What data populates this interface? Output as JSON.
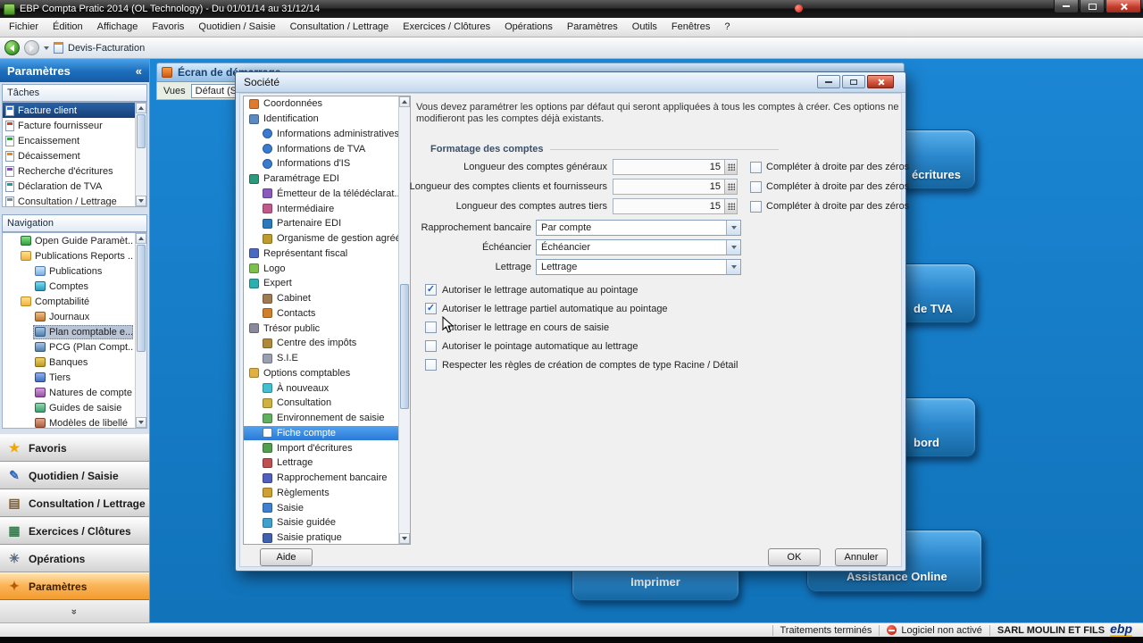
{
  "window": {
    "title": "EBP Compta Pratic 2014 (OL Technology) - Du 01/01/14 au 31/12/14"
  },
  "menubar": {
    "items": [
      "Fichier",
      "Édition",
      "Affichage",
      "Favoris",
      "Quotidien / Saisie",
      "Consultation / Lettrage",
      "Exercices / Clôtures",
      "Opérations",
      "Paramètres",
      "Outils",
      "Fenêtres",
      "?"
    ]
  },
  "toolbar": {
    "breadcrumb": "Devis-Facturation"
  },
  "sidebar": {
    "title": "Paramètres",
    "collapse_glyph": "«",
    "tasks_header": "Tâches",
    "tasks": [
      {
        "label": "Facture client",
        "icon": "doc-blue",
        "selected": true
      },
      {
        "label": "Facture fournisseur",
        "icon": "doc-red"
      },
      {
        "label": "Encaissement",
        "icon": "doc-green"
      },
      {
        "label": "Décaissement",
        "icon": "doc-orange"
      },
      {
        "label": "Recherche d'écritures",
        "icon": "doc-purple"
      },
      {
        "label": "Déclaration de TVA",
        "icon": "doc-teal"
      },
      {
        "label": "Consultation / Lettrage",
        "icon": "doc-gray"
      }
    ],
    "navigation_header": "Navigation",
    "nav": [
      {
        "label": "Open Guide Paramèt...",
        "level": 0,
        "icon": "guide"
      },
      {
        "label": "Publications Reports ...",
        "level": 0,
        "icon": "folder"
      },
      {
        "label": "Publications",
        "level": 1,
        "icon": "pages"
      },
      {
        "label": "Comptes",
        "level": 1,
        "icon": "gem"
      },
      {
        "label": "Comptabilité",
        "level": 0,
        "icon": "folder"
      },
      {
        "label": "Journaux",
        "level": 1,
        "icon": "journal"
      },
      {
        "label": "Plan comptable e...",
        "level": 1,
        "icon": "plan",
        "selected": true
      },
      {
        "label": "PCG (Plan Compt...)",
        "level": 1,
        "icon": "plan"
      },
      {
        "label": "Banques",
        "level": 1,
        "icon": "bank"
      },
      {
        "label": "Tiers",
        "level": 1,
        "icon": "person"
      },
      {
        "label": "Natures de compte",
        "level": 1,
        "icon": "nature"
      },
      {
        "label": "Guides de saisie",
        "level": 1,
        "icon": "guide2"
      },
      {
        "label": "Modèles de libellé",
        "level": 1,
        "icon": "model"
      }
    ],
    "accordion": [
      {
        "label": "Favoris",
        "icon": "star"
      },
      {
        "label": "Quotidien / Saisie",
        "icon": "pencil"
      },
      {
        "label": "Consultation / Lettrage",
        "icon": "book"
      },
      {
        "label": "Exercices / Clôtures",
        "icon": "calc"
      },
      {
        "label": "Opérations",
        "icon": "gears"
      },
      {
        "label": "Paramètres",
        "icon": "wrench",
        "active": true
      }
    ]
  },
  "start_screen": {
    "title": "Écran de démarrage",
    "views_label": "Vues",
    "views_value": "Défaut (Sys",
    "buttons": [
      {
        "label": "écritures"
      },
      {
        "label": "de TVA"
      },
      {
        "label": "bord"
      },
      {
        "label": "Imprimer"
      },
      {
        "label": "Assistance Online"
      }
    ]
  },
  "dialog": {
    "title": "Société",
    "description": "Vous devez paramétrer les options par défaut qui seront appliquées à tous les comptes  à créer. Ces options ne modifieront pas les comptes déjà existants.",
    "group_title": "Formatage des comptes",
    "tree": [
      {
        "label": "Coordonnées",
        "level": 0,
        "icon": "coord"
      },
      {
        "label": "Identification",
        "level": 0,
        "icon": "ident"
      },
      {
        "label": "Informations administratives",
        "level": 1,
        "icon": "info"
      },
      {
        "label": "Informations de TVA",
        "level": 1,
        "icon": "info"
      },
      {
        "label": "Informations d'IS",
        "level": 1,
        "icon": "info"
      },
      {
        "label": "Paramétrage EDI",
        "level": 0,
        "icon": "edi"
      },
      {
        "label": "Émetteur de la télédéclarat...",
        "level": 1,
        "icon": "emit"
      },
      {
        "label": "Intermédiaire",
        "level": 1,
        "icon": "inter"
      },
      {
        "label": "Partenaire EDI",
        "level": 1,
        "icon": "edi2"
      },
      {
        "label": "Organisme de gestion agréé",
        "level": 1,
        "icon": "org"
      },
      {
        "label": "Représentant fiscal",
        "level": 0,
        "icon": "rep"
      },
      {
        "label": "Logo",
        "level": 0,
        "icon": "logo"
      },
      {
        "label": "Expert",
        "level": 0,
        "icon": "expert"
      },
      {
        "label": "Cabinet",
        "level": 1,
        "icon": "cab"
      },
      {
        "label": "Contacts",
        "level": 1,
        "icon": "cont"
      },
      {
        "label": "Trésor public",
        "level": 0,
        "icon": "tresor"
      },
      {
        "label": "Centre des impôts",
        "level": 1,
        "icon": "centre"
      },
      {
        "label": "S.I.E",
        "level": 1,
        "icon": "sie"
      },
      {
        "label": "Options comptables",
        "level": 0,
        "icon": "opt"
      },
      {
        "label": "À nouveaux",
        "level": 1,
        "icon": "anouv"
      },
      {
        "label": "Consultation",
        "level": 1,
        "icon": "consult"
      },
      {
        "label": "Environnement de saisie",
        "level": 1,
        "icon": "env"
      },
      {
        "label": "Fiche compte",
        "level": 1,
        "icon": "fiche",
        "selected": true
      },
      {
        "label": "Import d'écritures",
        "level": 1,
        "icon": "import"
      },
      {
        "label": "Lettrage",
        "level": 1,
        "icon": "lettrage"
      },
      {
        "label": "Rapprochement bancaire",
        "level": 1,
        "icon": "rappro"
      },
      {
        "label": "Règlements",
        "level": 1,
        "icon": "regl"
      },
      {
        "label": "Saisie",
        "level": 1,
        "icon": "saisie"
      },
      {
        "label": "Saisie guidée",
        "level": 1,
        "icon": "saisieg"
      },
      {
        "label": "Saisie pratique",
        "level": 1,
        "icon": "saisiep"
      }
    ],
    "length_rows": [
      {
        "label": "Longueur des comptes généraux",
        "value": "15",
        "checked": false,
        "check_label": "Compléter à droite par des zéros"
      },
      {
        "label": "Longueur des comptes clients et fournisseurs",
        "value": "15",
        "checked": false,
        "check_label": "Compléter à droite par des zéros"
      },
      {
        "label": "Longueur des comptes autres tiers",
        "value": "15",
        "checked": false,
        "check_label": "Compléter à droite par des zéros"
      }
    ],
    "dropdown_rows": [
      {
        "label": "Rapprochement bancaire",
        "value": "Par compte"
      },
      {
        "label": "Échéancier",
        "value": "Échéancier"
      },
      {
        "label": "Lettrage",
        "value": "Lettrage"
      }
    ],
    "checkboxes": [
      {
        "label": "Autoriser le lettrage automatique au pointage",
        "checked": true
      },
      {
        "label": "Autoriser le lettrage partiel automatique au pointage",
        "checked": true
      },
      {
        "label": "Autoriser le lettrage en cours de saisie",
        "checked": false
      },
      {
        "label": "Autoriser le pointage automatique au lettrage",
        "checked": false
      },
      {
        "label": "Respecter les règles de création de comptes de type Racine / Détail",
        "checked": false
      }
    ],
    "buttons": {
      "help": "Aide",
      "ok": "OK",
      "cancel": "Annuler"
    }
  },
  "statusbar": {
    "status": "Traitements terminés",
    "license": "Logiciel non activé",
    "company": "SARL MOULIN ET FILS",
    "logo": "ebp"
  }
}
